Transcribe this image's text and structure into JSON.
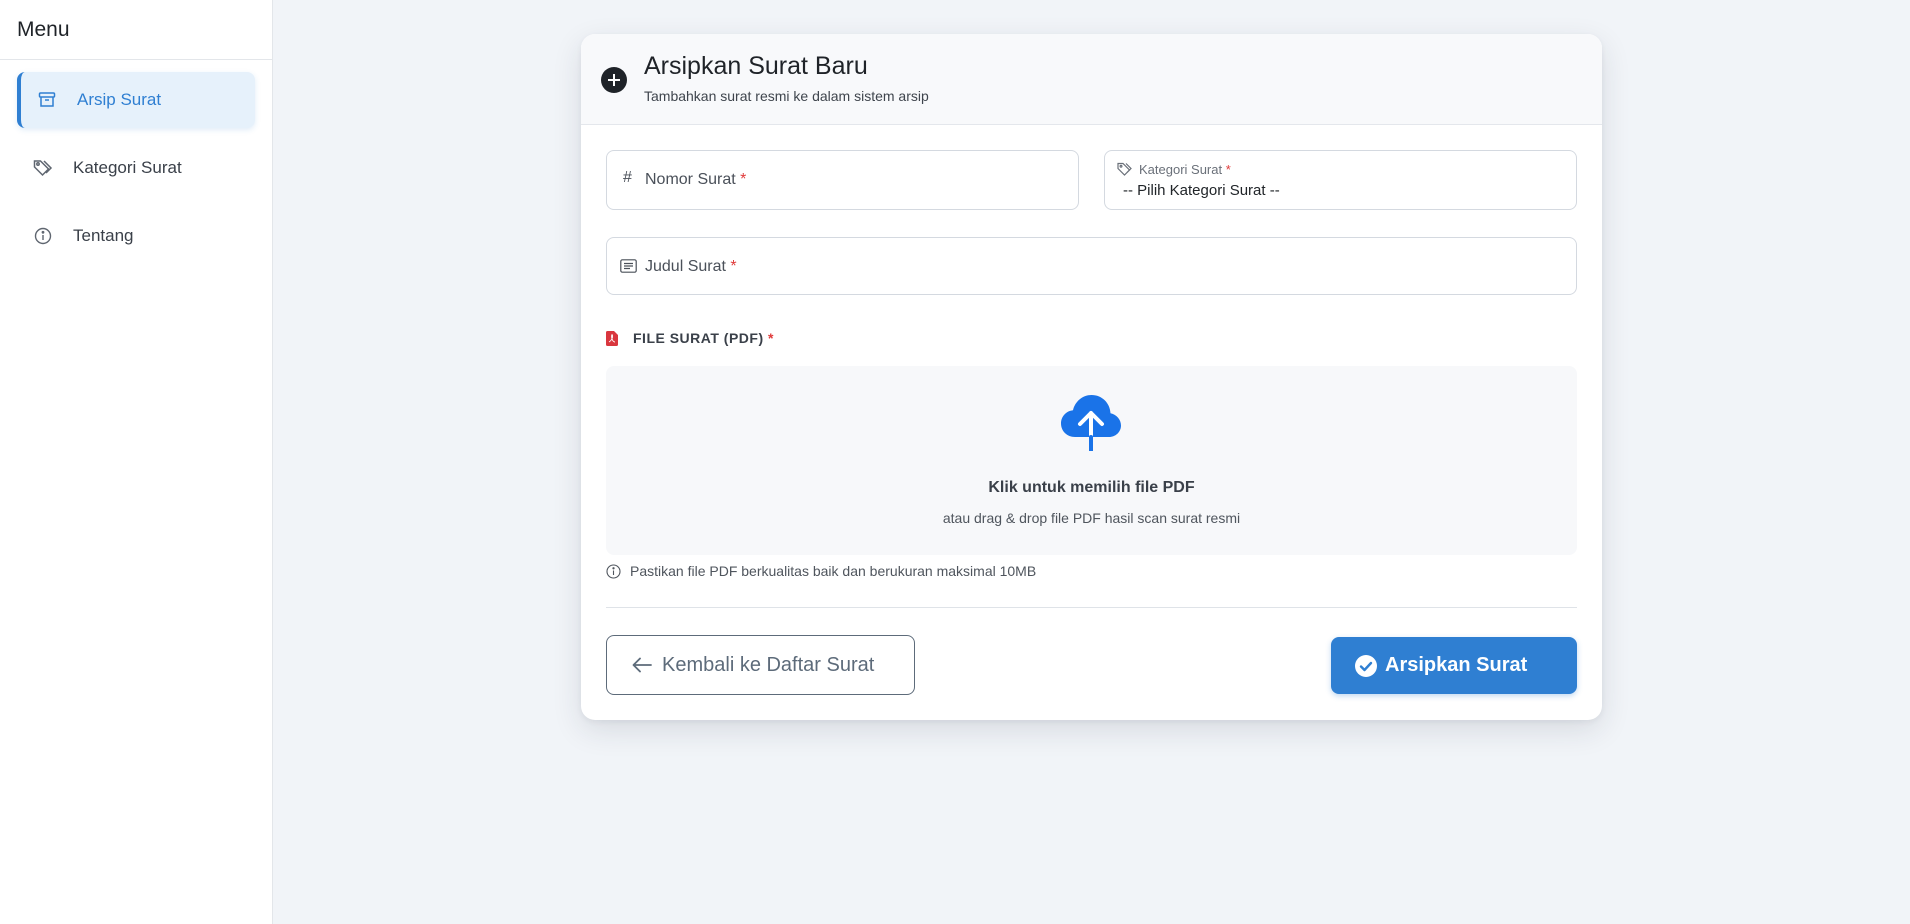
{
  "sidebar": {
    "title": "Menu",
    "items": [
      {
        "label": "Arsip Surat",
        "icon": "archive-icon",
        "active": true
      },
      {
        "label": "Kategori Surat",
        "icon": "tags-icon",
        "active": false
      },
      {
        "label": "Tentang",
        "icon": "info-icon",
        "active": false
      }
    ]
  },
  "form": {
    "title": "Arsipkan Surat Baru",
    "subtitle": "Tambahkan surat resmi ke dalam sistem arsip",
    "nomor_label": "Nomor Surat",
    "nomor_icon_glyph": "#",
    "kategori_label": "Kategori Surat",
    "kategori_selected": "-- Pilih Kategori Surat --",
    "judul_label": "Judul Surat",
    "required_mark": "*",
    "file_label": "FILE SURAT (PDF)",
    "dropzone_title": "Klik untuk memilih file PDF",
    "dropzone_subtitle": "atau drag & drop file PDF hasil scan surat resmi",
    "hint": "Pastikan file PDF berkualitas baik dan berukuran maksimal 10MB",
    "back_button": "Kembali ke Daftar Surat",
    "submit_button": "Arsipkan Surat"
  },
  "colors": {
    "accent": "#2f7fd2",
    "required": "#e03a3a",
    "pdf": "#d9363e",
    "upload": "#1a73e8"
  }
}
